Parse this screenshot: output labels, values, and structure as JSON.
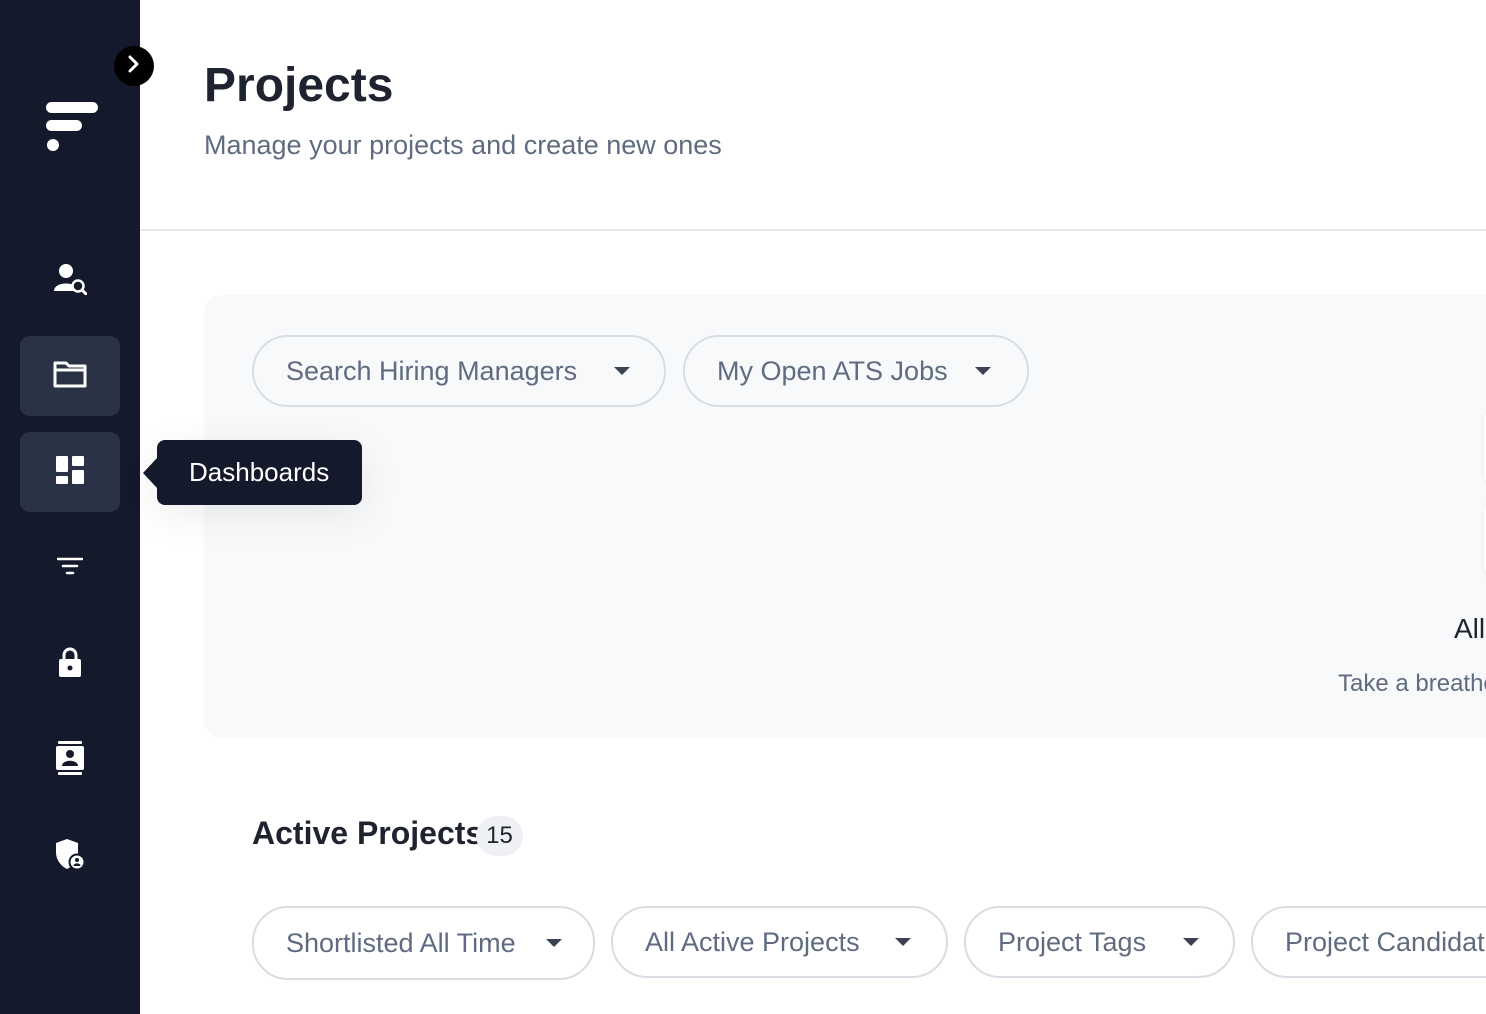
{
  "sidebar": {
    "expand_icon": "chevron-right-icon",
    "logo_icon": "brand-logo",
    "items": [
      {
        "name": "people-search",
        "icon": "user-search-icon"
      },
      {
        "name": "projects",
        "icon": "folder-icon",
        "active": true
      },
      {
        "name": "dashboards",
        "icon": "dashboard-icon"
      },
      {
        "name": "filters",
        "icon": "filter-lines-icon"
      },
      {
        "name": "security",
        "icon": "lock-icon"
      },
      {
        "name": "contacts",
        "icon": "contact-card-icon"
      },
      {
        "name": "admin",
        "icon": "shield-user-icon"
      }
    ],
    "tooltip": "Dashboards"
  },
  "header": {
    "title": "Projects",
    "subtitle": "Manage your projects and create new ones"
  },
  "panel": {
    "filters": [
      {
        "label": "Search Hiring Managers"
      },
      {
        "label": "My Open ATS Jobs"
      }
    ],
    "empty_title": "All",
    "empty_subtitle": "Take a breathe"
  },
  "active_projects": {
    "title": "Active Projects",
    "count": "15",
    "filters": [
      {
        "label": "Shortlisted All Time"
      },
      {
        "label": "All Active Projects"
      },
      {
        "label": "Project Tags"
      },
      {
        "label": "Project Candidat"
      }
    ]
  },
  "colors": {
    "sidebar_bg": "#141a2b",
    "active_item_bg": "#2a3245",
    "check_green": "#1f8a4c"
  }
}
